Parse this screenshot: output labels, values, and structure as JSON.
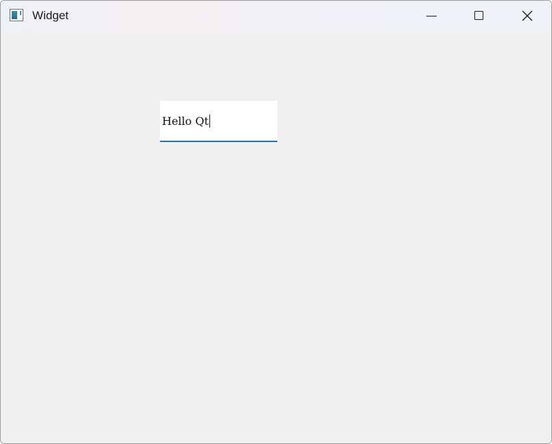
{
  "window": {
    "title": "Widget",
    "icon": "qt-app-icon",
    "controls": {
      "minimize": "minimize-icon",
      "maximize": "maximize-icon",
      "close": "close-icon"
    }
  },
  "line_edit": {
    "value": "Hello Qt",
    "focused": true,
    "accent_color": "#2b6cb8"
  }
}
